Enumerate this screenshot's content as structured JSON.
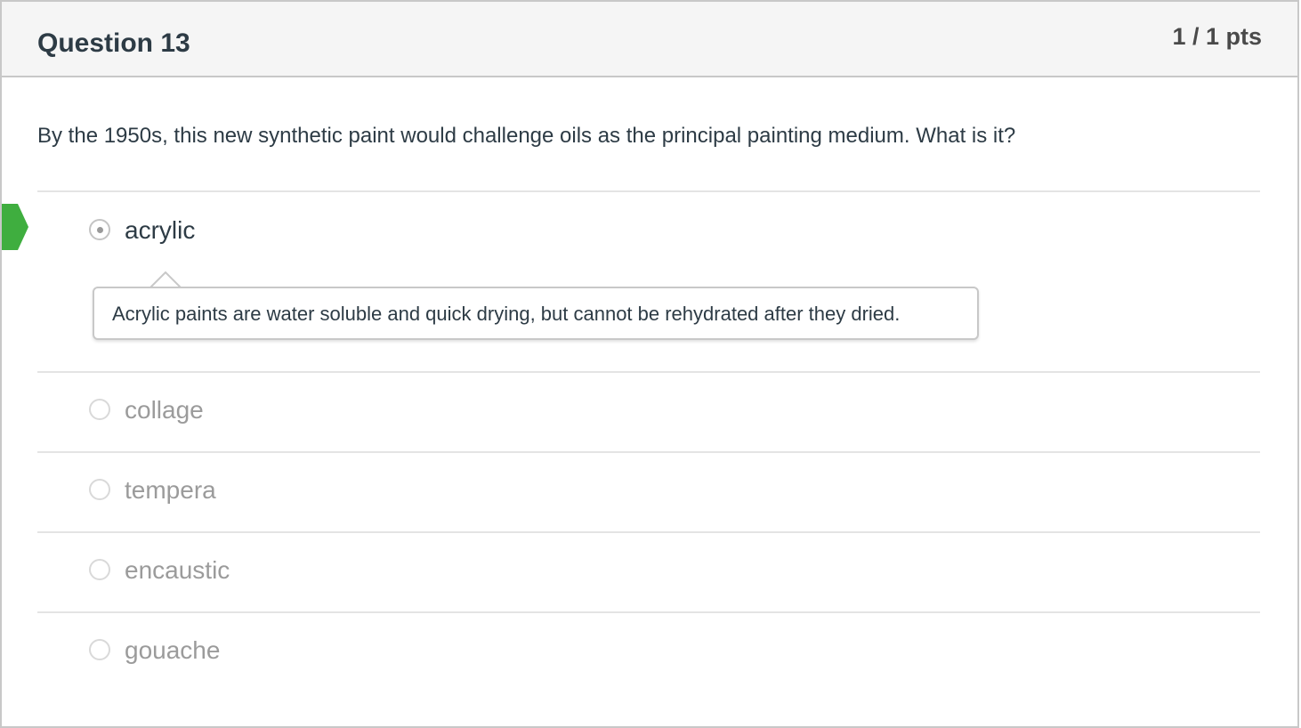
{
  "question": {
    "title": "Question 13",
    "points": "1 / 1 pts",
    "text": "By the 1950s, this new synthetic paint would challenge oils as the principal painting medium. What is it?"
  },
  "answers": [
    {
      "label": "acrylic",
      "selected": true,
      "correct": true
    },
    {
      "label": "collage",
      "selected": false
    },
    {
      "label": "tempera",
      "selected": false
    },
    {
      "label": "encaustic",
      "selected": false
    },
    {
      "label": "gouache",
      "selected": false
    }
  ],
  "comment": {
    "text": "Acrylic paints are water soluble and quick drying, but cannot be rehydrated after they dried."
  },
  "icons": {
    "correct_marker": "correct-answer-arrow-icon"
  },
  "colors": {
    "correct_marker": "#3fae3f",
    "header_bg": "#f5f5f5",
    "text_dark": "#2d3b45",
    "text_muted": "#9b9b9b"
  }
}
